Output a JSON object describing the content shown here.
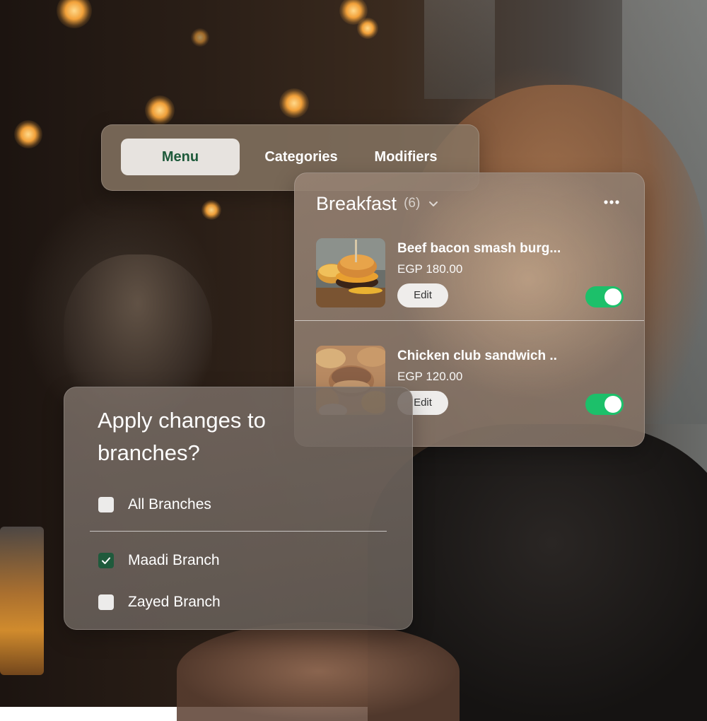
{
  "tabs": {
    "items": [
      {
        "label": "Menu",
        "active": true
      },
      {
        "label": "Categories",
        "active": false
      },
      {
        "label": "Modifiers",
        "active": false
      }
    ]
  },
  "menu_card": {
    "category_title": "Breakfast",
    "category_count": "(6)",
    "items": [
      {
        "name": "Beef bacon smash burg...",
        "price": "EGP 180.00",
        "edit_label": "Edit",
        "available": true,
        "image": "burger-photo"
      },
      {
        "name": "Chicken club sandwich ..",
        "price": "EGP 120.00",
        "edit_label": "Edit",
        "available": true,
        "image": "sandwich-photo"
      }
    ]
  },
  "branch_dialog": {
    "title_line1": "Apply changes to",
    "title_line2": "branches?",
    "options": [
      {
        "label": "All Branches",
        "checked": false
      },
      {
        "label": "Maadi Branch",
        "checked": true
      },
      {
        "label": "Zayed Branch",
        "checked": false
      }
    ]
  },
  "colors": {
    "accent_green": "#1e5a3a",
    "toggle_on": "#1cc06a"
  }
}
